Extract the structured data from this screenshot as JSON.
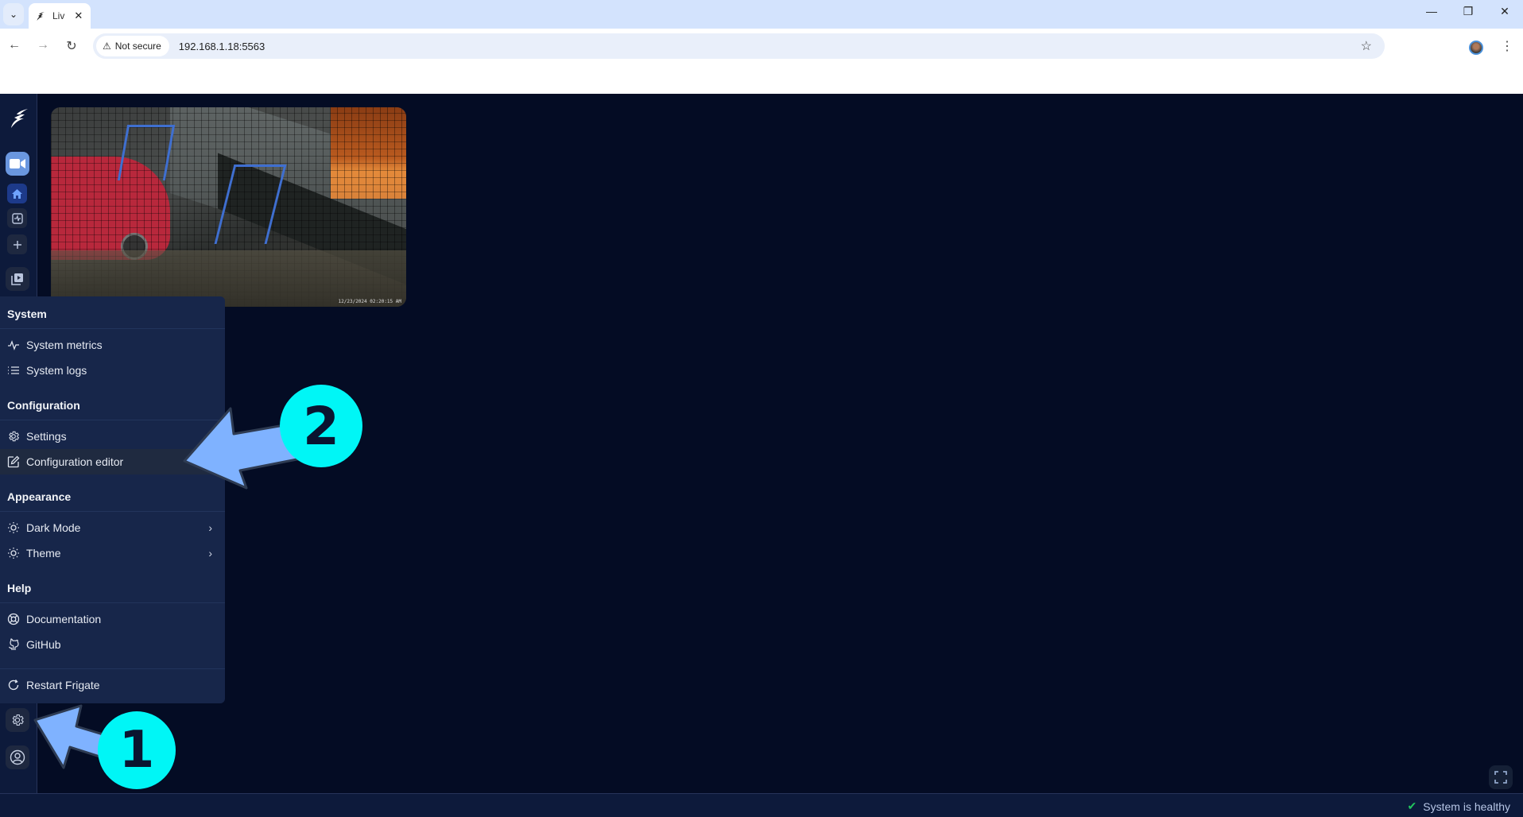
{
  "browser": {
    "tab_title": "Liv",
    "security_label": "Not secure",
    "url": "192.168.1.18:5563",
    "icons": {
      "tab_list": "chevron-down-icon",
      "tab_close": "close-icon",
      "back": "arrow-left-icon",
      "forward": "arrow-right-icon",
      "reload": "reload-icon",
      "warning": "warning-triangle-icon",
      "bookmark": "star-icon",
      "profile": "avatar",
      "menu": "kebab-icon",
      "minimize": "minimize-icon",
      "restore": "restore-icon",
      "close": "close-icon"
    },
    "glyphs": {
      "tab_list": "⌄",
      "tab_close": "✕",
      "back": "←",
      "forward": "→",
      "reload": "↻",
      "warning": "⚠",
      "bookmark": "☆",
      "menu": "⋮",
      "minimize": "—",
      "restore": "❐",
      "close": "✕"
    }
  },
  "sidebar": {
    "items": [
      {
        "name": "live",
        "icon": "video-camera-icon",
        "active": true
      },
      {
        "name": "home",
        "icon": "home-icon",
        "active": true
      },
      {
        "name": "activity",
        "icon": "activity-icon"
      },
      {
        "name": "add",
        "icon": "plus-icon"
      },
      {
        "name": "playback",
        "icon": "play-stack-icon"
      }
    ],
    "bottom": [
      {
        "name": "settings",
        "icon": "gear-icon"
      },
      {
        "name": "account",
        "icon": "user-circle-icon"
      }
    ]
  },
  "camera": {
    "timestamp": "12/23/2024 02:20:15 AM"
  },
  "menu": {
    "sections": [
      {
        "title": "System",
        "items": [
          {
            "label": "System metrics",
            "icon": "activity-line-icon"
          },
          {
            "label": "System logs",
            "icon": "list-icon"
          }
        ]
      },
      {
        "title": "Configuration",
        "items": [
          {
            "label": "Settings",
            "icon": "gear-icon"
          },
          {
            "label": "Configuration editor",
            "icon": "edit-icon",
            "highlighted": true
          }
        ]
      },
      {
        "title": "Appearance",
        "items": [
          {
            "label": "Dark Mode",
            "icon": "sun-icon",
            "submenu": true
          },
          {
            "label": "Theme",
            "icon": "sun-icon",
            "submenu": true
          }
        ]
      },
      {
        "title": "Help",
        "items": [
          {
            "label": "Documentation",
            "icon": "lifebuoy-icon"
          },
          {
            "label": "GitHub",
            "icon": "github-icon"
          }
        ]
      }
    ],
    "restart_label": "Restart Frigate",
    "chevron": "›"
  },
  "status": {
    "text": "System is healthy",
    "check": "✔",
    "color": "#22c55e"
  },
  "annotations": [
    {
      "number": "1",
      "points_to": "settings-sidebar-button"
    },
    {
      "number": "2",
      "points_to": "Configuration editor"
    }
  ]
}
